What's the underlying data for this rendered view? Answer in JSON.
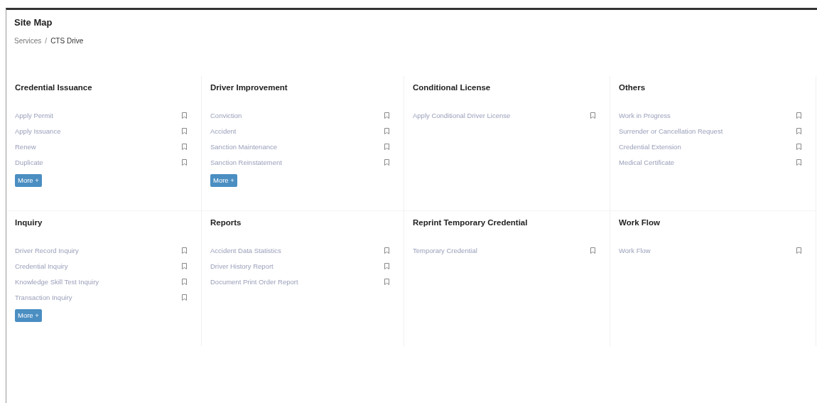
{
  "page_title": "Site Map",
  "breadcrumb": [
    {
      "label": "Services"
    },
    {
      "label": "CTS Drive"
    }
  ],
  "breadcrumb_separator": "/",
  "sections": [
    {
      "title": "Credential Issuance",
      "items": [
        "Apply Permit",
        "Apply Issuance",
        "Renew",
        "Duplicate"
      ],
      "more": "More +"
    },
    {
      "title": "Driver Improvement",
      "items": [
        "Conviction",
        "Accident",
        "Sanction Maintenance",
        "Sanction Reinstatement"
      ],
      "more": "More +"
    },
    {
      "title": "Conditional License",
      "items": [
        "Apply Conditional Driver License"
      ]
    },
    {
      "title": "Others",
      "items": [
        "Work in Progress",
        "Surrender or Cancellation Request",
        "Credential Extension",
        "Medical Certificate"
      ]
    },
    {
      "title": "Inquiry",
      "items": [
        "Driver Record Inquiry",
        "Credential Inquiry",
        "Knowledge Skill Test Inquiry",
        "Transaction Inquiry"
      ],
      "more": "More +"
    },
    {
      "title": "Reports",
      "items": [
        "Accident Data Statistics",
        "Driver History Report",
        "Document Print Order Report"
      ]
    },
    {
      "title": "Reprint Temporary Credential",
      "items": [
        "Temporary Credential"
      ]
    },
    {
      "title": "Work Flow",
      "items": [
        "Work Flow"
      ]
    }
  ]
}
